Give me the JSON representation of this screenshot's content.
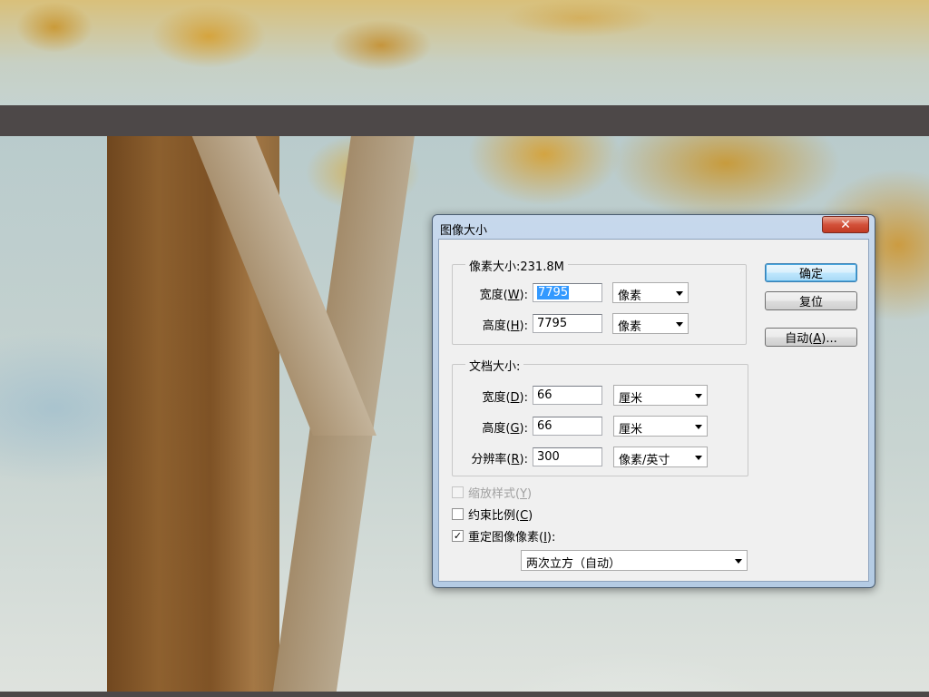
{
  "dialog": {
    "title": "图像大小",
    "close_symbol": "✕"
  },
  "pixel_dimensions": {
    "legend": "像素大小:231.8M",
    "width": {
      "label": "宽度(W):",
      "value": "7795",
      "unit": "像素"
    },
    "height": {
      "label": "高度(H):",
      "value": "7795",
      "unit": "像素"
    }
  },
  "document_size": {
    "legend": "文档大小:",
    "width": {
      "label": "宽度(D):",
      "value": "66",
      "unit": "厘米"
    },
    "height": {
      "label": "高度(G):",
      "value": "66",
      "unit": "厘米"
    },
    "resolution": {
      "label": "分辨率(R):",
      "value": "300",
      "unit": "像素/英寸"
    }
  },
  "options": {
    "scale_styles": {
      "label": "缩放样式(Y)",
      "checked": false,
      "enabled": false
    },
    "constrain_proportions": {
      "label": "约束比例(C)",
      "checked": false,
      "enabled": true
    },
    "resample": {
      "label": "重定图像像素(I):",
      "checked": true,
      "enabled": true
    },
    "resample_method": "两次立方（自动）"
  },
  "buttons": {
    "ok": "确定",
    "reset": "复位",
    "auto": "自动(A)..."
  },
  "icons": {
    "close": "close-icon",
    "dropdown": "chevron-down-icon",
    "check": "checkmark-icon"
  },
  "colors": {
    "close_button": "#c23a22",
    "selection": "#3399ff",
    "dialog_frame": "#b4cbe4",
    "band": "#4d4848"
  }
}
